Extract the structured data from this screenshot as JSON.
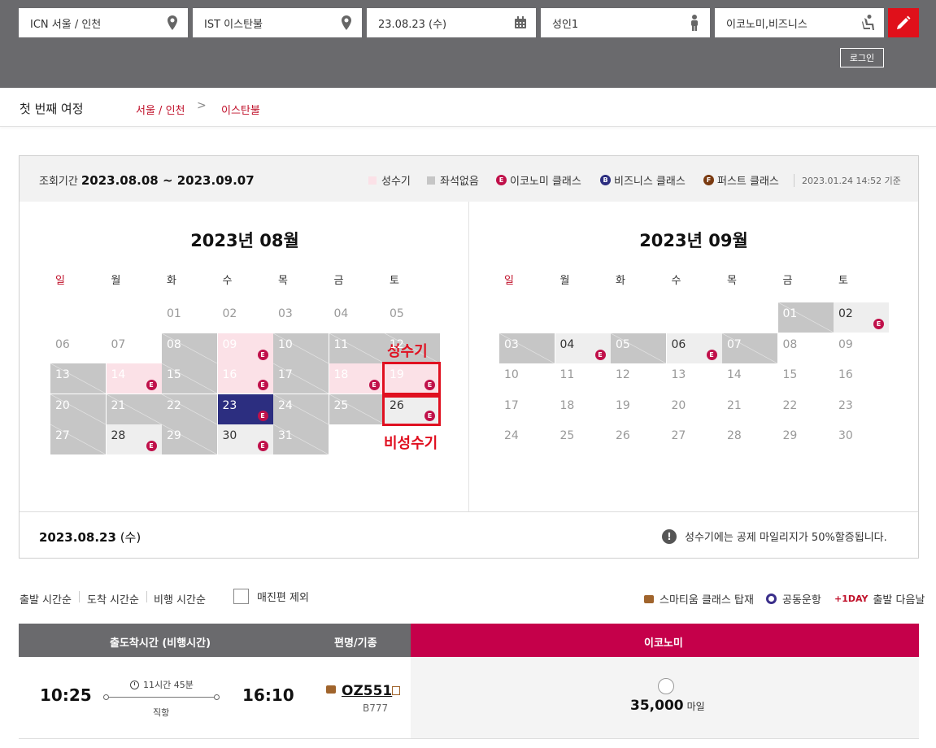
{
  "search": {
    "origin": "ICN 서울 / 인천",
    "destination": "IST 이스탄불",
    "date": "23.08.23 (수)",
    "passengers": "성인1",
    "cabin": "이코노미,비즈니스",
    "login_label": "로그인"
  },
  "breadcrumb": {
    "title": "첫 번째 여정",
    "from": "서울 / 인천",
    "separator": ">",
    "to": "이스탄불"
  },
  "calendar": {
    "period_label": "조회기간",
    "period_value": "2023.08.08 ~ 2023.09.07",
    "legend": {
      "peak": "성수기",
      "no_seat": "좌석없음",
      "economy": "이코노미 클래스",
      "business": "비즈니스 클래스",
      "first": "퍼스트 클래스",
      "badge_e": "E",
      "badge_b": "B",
      "badge_f": "F"
    },
    "timestamp": "2023.01.24 14:52 기준",
    "weekdays": [
      "일",
      "월",
      "화",
      "수",
      "목",
      "금",
      "토"
    ],
    "august": {
      "title": "2023년 08월",
      "days": [
        {
          "d": "01",
          "s": "dim"
        },
        {
          "d": "02",
          "s": "dim"
        },
        {
          "d": "03",
          "s": "dim"
        },
        {
          "d": "04",
          "s": "dim"
        },
        {
          "d": "05",
          "s": "dim"
        },
        {
          "d": "06",
          "s": "dim"
        },
        {
          "d": "07",
          "s": "dim"
        },
        {
          "d": "08",
          "s": "gray"
        },
        {
          "d": "09",
          "s": "pink",
          "e": true
        },
        {
          "d": "10",
          "s": "gray"
        },
        {
          "d": "11",
          "s": "gray"
        },
        {
          "d": "12",
          "s": "gray"
        },
        {
          "d": "13",
          "s": "gray"
        },
        {
          "d": "14",
          "s": "pink",
          "e": true
        },
        {
          "d": "15",
          "s": "gray"
        },
        {
          "d": "16",
          "s": "pink",
          "e": true
        },
        {
          "d": "17",
          "s": "gray"
        },
        {
          "d": "18",
          "s": "pink",
          "e": true
        },
        {
          "d": "19",
          "s": "pink",
          "e": true
        },
        {
          "d": "20",
          "s": "gray"
        },
        {
          "d": "21",
          "s": "gray"
        },
        {
          "d": "22",
          "s": "gray"
        },
        {
          "d": "23",
          "s": "sel",
          "e": true
        },
        {
          "d": "24",
          "s": "gray"
        },
        {
          "d": "25",
          "s": "gray"
        },
        {
          "d": "26",
          "s": "light",
          "e": true
        },
        {
          "d": "27",
          "s": "gray"
        },
        {
          "d": "28",
          "s": "light",
          "e": true
        },
        {
          "d": "29",
          "s": "gray"
        },
        {
          "d": "30",
          "s": "light",
          "e": true
        },
        {
          "d": "31",
          "s": "gray"
        }
      ]
    },
    "september": {
      "title": "2023년 09월",
      "days": [
        {
          "d": "01",
          "s": "gray"
        },
        {
          "d": "02",
          "s": "light",
          "e": true
        },
        {
          "d": "03",
          "s": "gray"
        },
        {
          "d": "04",
          "s": "light",
          "e": true
        },
        {
          "d": "05",
          "s": "gray"
        },
        {
          "d": "06",
          "s": "light",
          "e": true
        },
        {
          "d": "07",
          "s": "gray"
        },
        {
          "d": "08",
          "s": "dim"
        },
        {
          "d": "09",
          "s": "dim"
        },
        {
          "d": "10",
          "s": "dim"
        },
        {
          "d": "11",
          "s": "dim"
        },
        {
          "d": "12",
          "s": "dim"
        },
        {
          "d": "13",
          "s": "dim"
        },
        {
          "d": "14",
          "s": "dim"
        },
        {
          "d": "15",
          "s": "dim"
        },
        {
          "d": "16",
          "s": "dim"
        },
        {
          "d": "17",
          "s": "dim"
        },
        {
          "d": "18",
          "s": "dim"
        },
        {
          "d": "19",
          "s": "dim"
        },
        {
          "d": "20",
          "s": "dim"
        },
        {
          "d": "21",
          "s": "dim"
        },
        {
          "d": "22",
          "s": "dim"
        },
        {
          "d": "23",
          "s": "dim"
        },
        {
          "d": "24",
          "s": "dim"
        },
        {
          "d": "25",
          "s": "dim"
        },
        {
          "d": "26",
          "s": "dim"
        },
        {
          "d": "27",
          "s": "dim"
        },
        {
          "d": "28",
          "s": "dim"
        },
        {
          "d": "29",
          "s": "dim"
        },
        {
          "d": "30",
          "s": "dim"
        }
      ]
    },
    "annotation_peak": "성수기",
    "annotation_offpeak": "비성수기",
    "selected_date": "2023.08.23",
    "selected_dow": "(수)",
    "notice": "성수기에는 공제 마일리지가 50%할증됩니다.",
    "notice_icon": "!"
  },
  "sort": {
    "departure": "출발 시간순",
    "arrival": "도착 시간순",
    "duration": "비행 시간순",
    "exclude_soldout": "매진편 제외",
    "smartium": "스마티움 클래스 탑재",
    "codeshare": "공동운항",
    "oneday_badge": "+1DAY",
    "oneday": "출발 다음날"
  },
  "table": {
    "col_time": "출도착시간 (비행시간)",
    "col_flight": "편명/기종",
    "col_economy": "이코노미"
  },
  "flight": {
    "depart": "10:25",
    "arrive": "16:10",
    "duration": "11시간 45분",
    "stops": "직항",
    "number": "OZ551",
    "aircraft": "B777",
    "miles": "35,000",
    "miles_unit": "마일"
  },
  "colors": {
    "brand_red": "#c5004a",
    "header_gray": "#6a6a6d",
    "peak_pink": "#fbe1e7",
    "noseat_gray": "#c6c6c6",
    "selected_navy": "#2c2e80"
  }
}
